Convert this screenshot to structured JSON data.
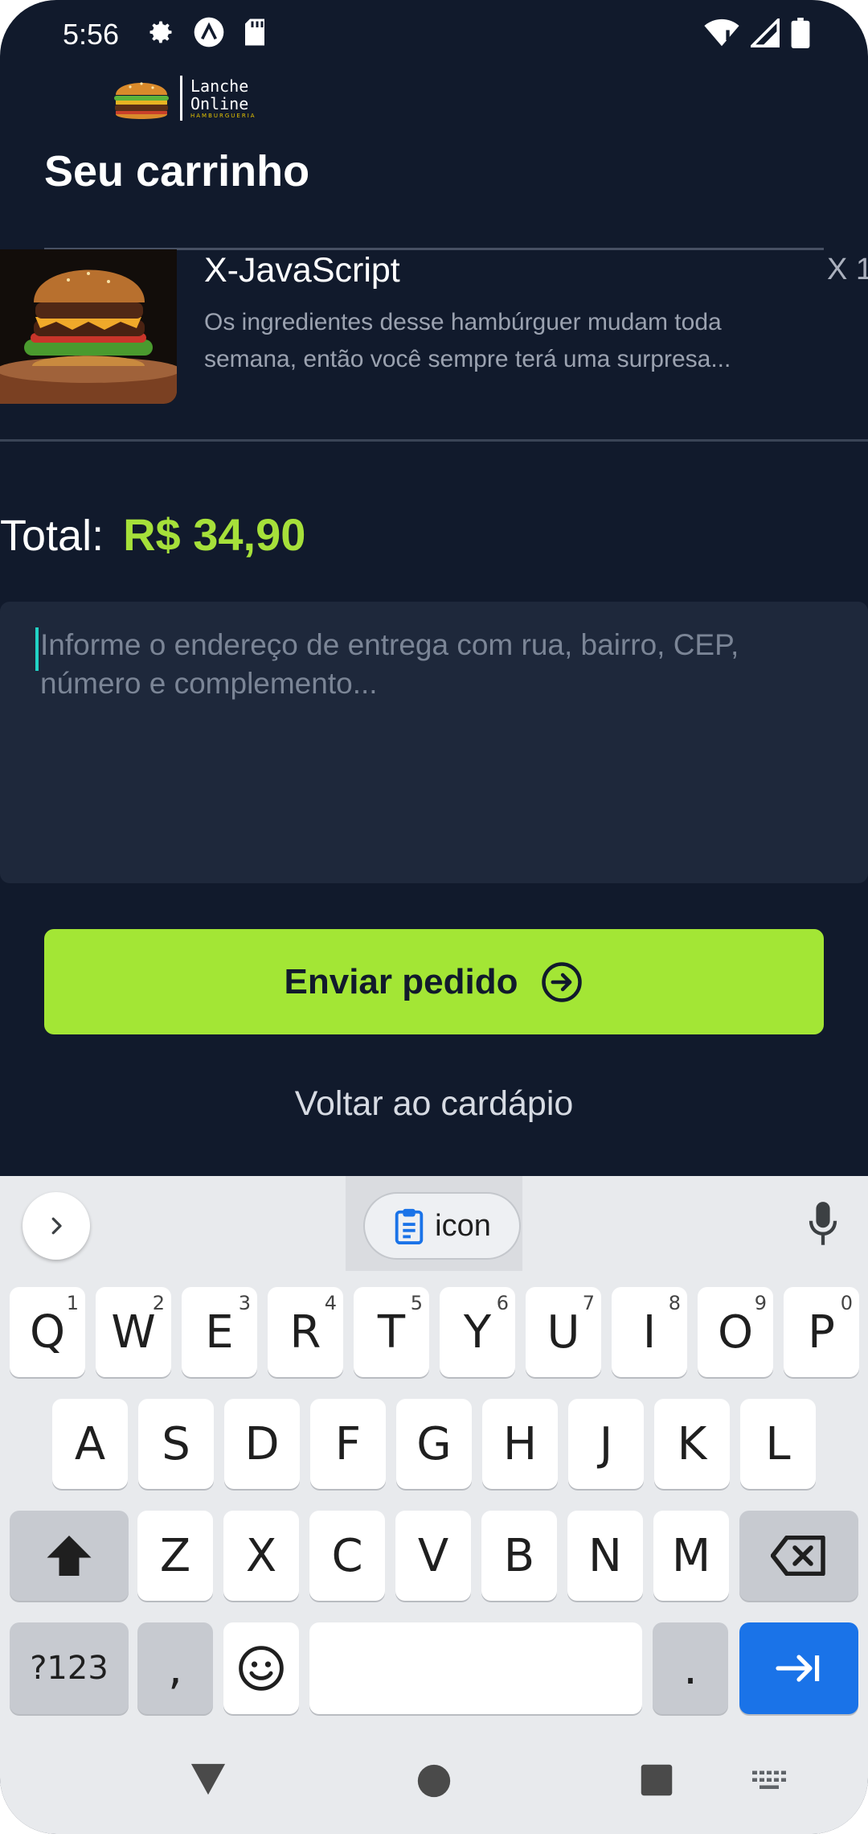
{
  "status_bar": {
    "time": "5:56"
  },
  "header": {
    "logo_line1": "Lanche",
    "logo_line2": "Online",
    "logo_tagline": "HAMBURGUERIA",
    "title": "Seu carrinho"
  },
  "cart": {
    "items": [
      {
        "name": "X-JavaScript",
        "quantity": "X 1",
        "description": "Os ingredientes desse hambúrguer mudam toda semana, então você sempre terá uma surpresa..."
      }
    ],
    "total_label": "Total:",
    "total_value": "R$ 34,90"
  },
  "address": {
    "placeholder": "Informe o endereço de entrega com rua, bairro, CEP,   número e complemento..."
  },
  "actions": {
    "send_label": "Enviar pedido",
    "back_label": "Voltar ao cardápio"
  },
  "keyboard": {
    "suggestion": "icon",
    "row1": [
      {
        "k": "Q",
        "h": "1"
      },
      {
        "k": "W",
        "h": "2"
      },
      {
        "k": "E",
        "h": "3"
      },
      {
        "k": "R",
        "h": "4"
      },
      {
        "k": "T",
        "h": "5"
      },
      {
        "k": "Y",
        "h": "6"
      },
      {
        "k": "U",
        "h": "7"
      },
      {
        "k": "I",
        "h": "8"
      },
      {
        "k": "O",
        "h": "9"
      },
      {
        "k": "P",
        "h": "0"
      }
    ],
    "row2": [
      "A",
      "S",
      "D",
      "F",
      "G",
      "H",
      "J",
      "K",
      "L"
    ],
    "row3": [
      "Z",
      "X",
      "C",
      "V",
      "B",
      "N",
      "M"
    ],
    "symbols_label": "?123",
    "comma": ",",
    "period": "."
  },
  "colors": {
    "background": "#111a2c",
    "accent": "#a3e635",
    "price": "#a6e03a",
    "field": "#1e283b",
    "enter_key": "#1a73e8"
  }
}
